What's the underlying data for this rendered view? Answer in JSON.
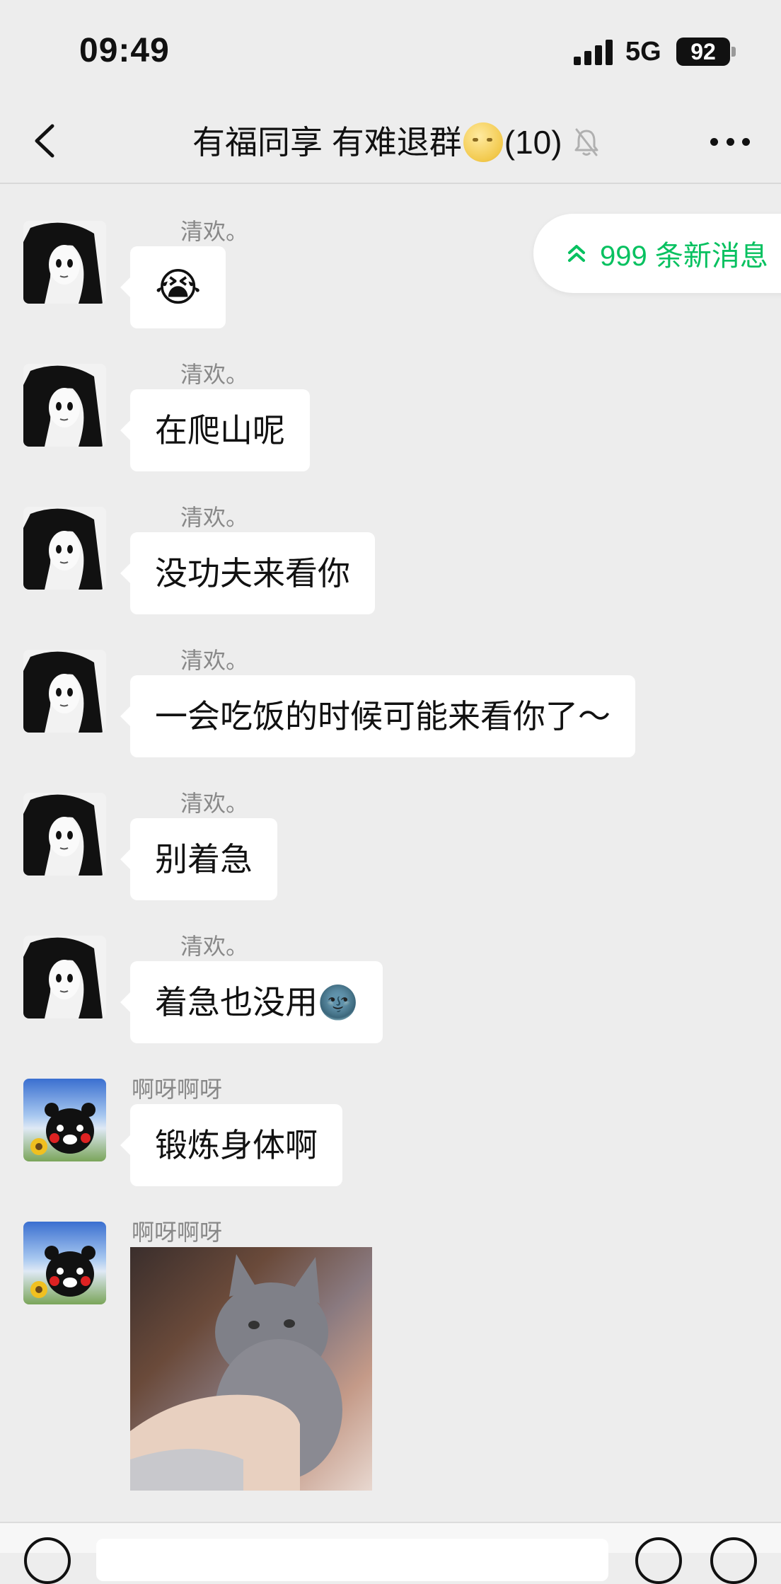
{
  "status": {
    "time": "09:49",
    "network": "5G",
    "battery": "92"
  },
  "nav": {
    "title_prefix": "有福同享 有难退群",
    "title_emoji": "moon-face-emoji",
    "member_count": "(10)",
    "muted_icon": "bell-off-icon",
    "more_icon": "more-dots-icon",
    "back_icon": "back-chevron-icon"
  },
  "new_messages": {
    "label": "999 条新消息",
    "icon": "double-chevron-up-icon",
    "color": "#07c160"
  },
  "messages": [
    {
      "sender": "清欢。",
      "text": "😭",
      "avatar": "anime-girl-avatar"
    },
    {
      "sender": "清欢。",
      "text": "在爬山呢",
      "avatar": "anime-girl-avatar"
    },
    {
      "sender": "清欢。",
      "text": "没功夫来看你",
      "avatar": "anime-girl-avatar"
    },
    {
      "sender": "清欢。",
      "text": "一会吃饭的时候可能来看你了～",
      "avatar": "anime-girl-avatar"
    },
    {
      "sender": "清欢。",
      "text": "别着急",
      "avatar": "anime-girl-avatar"
    },
    {
      "sender": "清欢。",
      "text": "着急也没用🌚",
      "avatar": "anime-girl-avatar"
    },
    {
      "sender": "啊呀啊呀",
      "text": "锻炼身体啊",
      "avatar": "kumamon-avatar"
    },
    {
      "sender": "啊呀啊呀",
      "sticker": "gray-kitten-sticker",
      "avatar": "kumamon-avatar"
    }
  ]
}
